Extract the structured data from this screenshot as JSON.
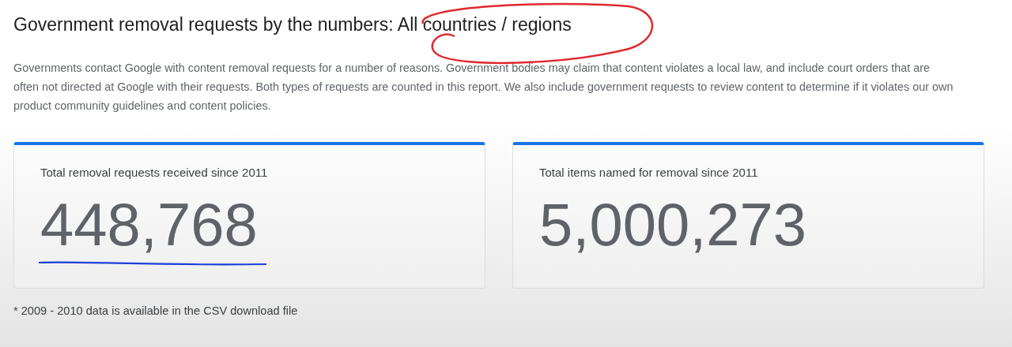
{
  "heading": "Government removal requests by the numbers: All countries / regions",
  "intro": "Governments contact Google with content removal requests for a number of reasons. Government bodies may claim that content violates a local law, and include court orders that are often not directed at Google with their requests. Both types of requests are counted in this report. We also include government requests to review content to determine if it violates our own product community guidelines and content policies.",
  "cards": [
    {
      "label": "Total removal requests received since 2011",
      "value": "448,768",
      "marked": true
    },
    {
      "label": "Total items named for removal since 2011",
      "value": "5,000,273",
      "marked": false
    }
  ],
  "footnote": "* 2009 - 2010 data is available in the CSV download file",
  "annotations": [
    {
      "kind": "circle",
      "color": "#e0282e"
    },
    {
      "kind": "underline",
      "color": "#1a3fd6"
    }
  ]
}
